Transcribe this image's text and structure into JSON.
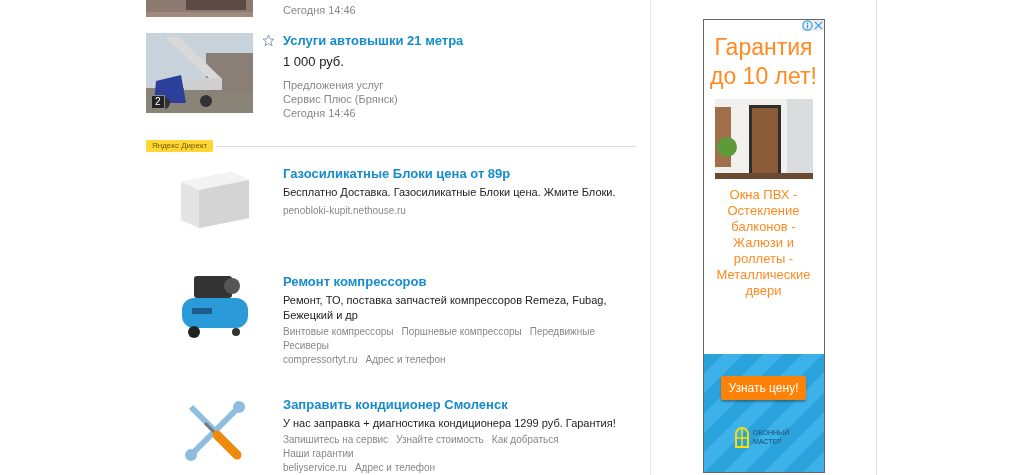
{
  "listings": [
    {
      "kind": "partial",
      "date": "Сегодня 14:46"
    },
    {
      "kind": "full",
      "favorite": false,
      "title": "Услуги автовышки 21 метра",
      "price": "1 000 руб.",
      "photo_count": "2",
      "category": "Предложения услуг",
      "seller": "Сервис Плюс (Брянск)",
      "date": "Сегодня 14:46"
    }
  ],
  "direct": {
    "badge": "Яндекс Директ",
    "ads": [
      {
        "kind": "block",
        "title": "Газосиликатные Блоки цена от 89р",
        "text": "Бесплатно Доставка. Газосиликатные Блоки цена. Жмите Блоки.",
        "domain": "penobloki-kupit.nethouse.ru"
      },
      {
        "kind": "compressor",
        "title": "Ремонт компрессоров",
        "text": "Ремонт, ТО, поставка запчастей компрессоров Remeza, Fubag, Бежецкий и др",
        "links": [
          "Винтовые компрессоры",
          "Поршневые компрессоры",
          "Передвижные",
          "Ресиверы"
        ],
        "domain": "compressortyt.ru",
        "contact": "Адрес и телефон"
      },
      {
        "kind": "tools",
        "title": "Заправить кондиционер Смоленск",
        "text": "У нас заправка + диагностика кондиционера 1299 руб. Гарантия!",
        "links": [
          "Запишитесь на сервис",
          "Узнайте стоимость",
          "Как добраться",
          "Наши гарантии"
        ],
        "domain": "beliyservice.ru",
        "contact": "Адрес и телефон"
      }
    ]
  },
  "banner": {
    "headline": "Гарантия до 10 лет!",
    "text": "Окна ПВХ - Остекление балконов - Жалюзи и роллеты - Металлические двери",
    "button": "Узнать цену!",
    "logo": "ОКОННЫЙ МАСТЕР"
  }
}
